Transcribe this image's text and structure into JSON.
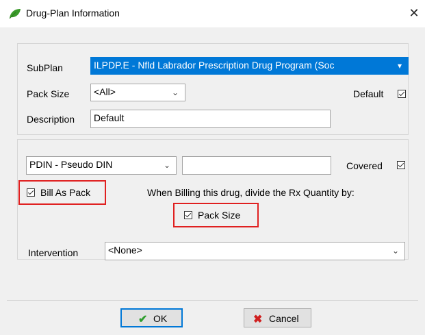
{
  "window": {
    "title": "Drug-Plan Information"
  },
  "plan": {
    "subplan_label": "SubPlan",
    "subplan_value": "ILPDP.E - Nfld Labrador Prescription Drug Program (Soc",
    "pack_size_label": "Pack Size",
    "pack_size_value": "<All>",
    "default_label": "Default",
    "description_label": "Description",
    "description_value": "Default"
  },
  "billing": {
    "din_value": "PDIN - Pseudo DIN",
    "din_text_value": "",
    "covered_label": "Covered",
    "bill_as_pack_label": "Bill As Pack",
    "divide_text": "When Billing this drug, divide the Rx Quantity by:",
    "pack_size_checkbox_label": "Pack Size"
  },
  "intervention": {
    "label": "Intervention",
    "value": "<None>"
  },
  "buttons": {
    "ok_label": "OK",
    "cancel_label": "Cancel"
  },
  "colors": {
    "selection": "#0078d7",
    "highlight_box": "#e02020",
    "ok_icon": "#2e9e2e",
    "cancel_icon": "#d02020",
    "leaf": "#3a9a2a"
  }
}
